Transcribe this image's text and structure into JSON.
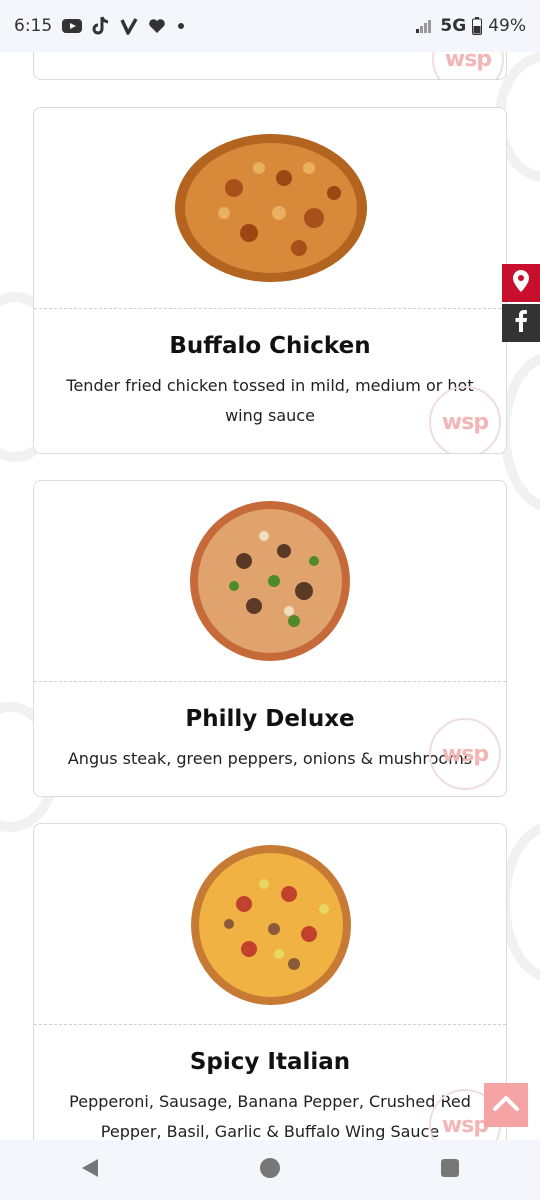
{
  "status_bar": {
    "time": "6:15",
    "notification_icons": [
      "youtube-icon",
      "tiktok-icon",
      "venmo-icon",
      "heart-icon",
      "dot-icon"
    ],
    "network": "5G",
    "battery": "49%"
  },
  "menu": {
    "items": [
      {
        "name": "Buffalo Chicken",
        "description": "Tender fried chicken tossed in mild, medium or hot wing sauce",
        "image": "buffalo-chicken-pizza"
      },
      {
        "name": "Philly Deluxe",
        "description": "Angus steak, green peppers, onions & mushrooms",
        "image": "philly-deluxe-pizza"
      },
      {
        "name": "Spicy Italian",
        "description": "Pepperoni, Sausage, Banana Pepper, Crushed Red Pepper, Basil, Garlic & Buffalo Wing Sauce",
        "image": "spicy-italian-pizza"
      }
    ]
  },
  "stamp": {
    "text": "wsp",
    "color": "#f3b5b5"
  },
  "side_buttons": {
    "location": "location-pin-icon",
    "facebook": "facebook-icon"
  },
  "colors": {
    "accent": "#c8102e",
    "dark": "#333333",
    "back_to_top": "#f6a3a6"
  },
  "nav_bar": {
    "back": "back-icon",
    "home": "home-icon",
    "recents": "recents-icon"
  }
}
